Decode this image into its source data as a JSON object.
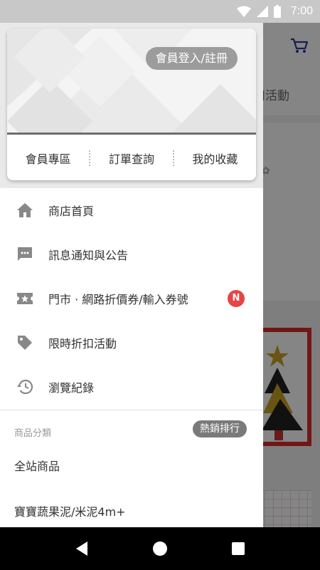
{
  "status_bar": {
    "time": "7:00"
  },
  "background": {
    "tab_partial": "扣活動"
  },
  "drawer": {
    "login_button": "會員登入/註冊",
    "member_links": [
      "會員專區",
      "訂單查詢",
      "我的收藏"
    ],
    "menu": [
      {
        "label": "商店首頁",
        "icon": "home-icon"
      },
      {
        "label": "訊息通知與公告",
        "icon": "message-icon"
      },
      {
        "label": "門市 · 網路折價券/輸入券號",
        "icon": "ticket-icon",
        "badge": "N"
      },
      {
        "label": "限時折扣活動",
        "icon": "tag-icon"
      },
      {
        "label": "瀏覽紀錄",
        "icon": "history-icon"
      }
    ],
    "category_header": "商品分類",
    "hot_ranking": "熱銷排行",
    "categories": [
      "全站商品",
      "寶寶蔬果泥/米泥4m+"
    ]
  },
  "colors": {
    "badge": "#e94444",
    "accent_cart": "#2d3a9b",
    "scrim": "#000000"
  }
}
